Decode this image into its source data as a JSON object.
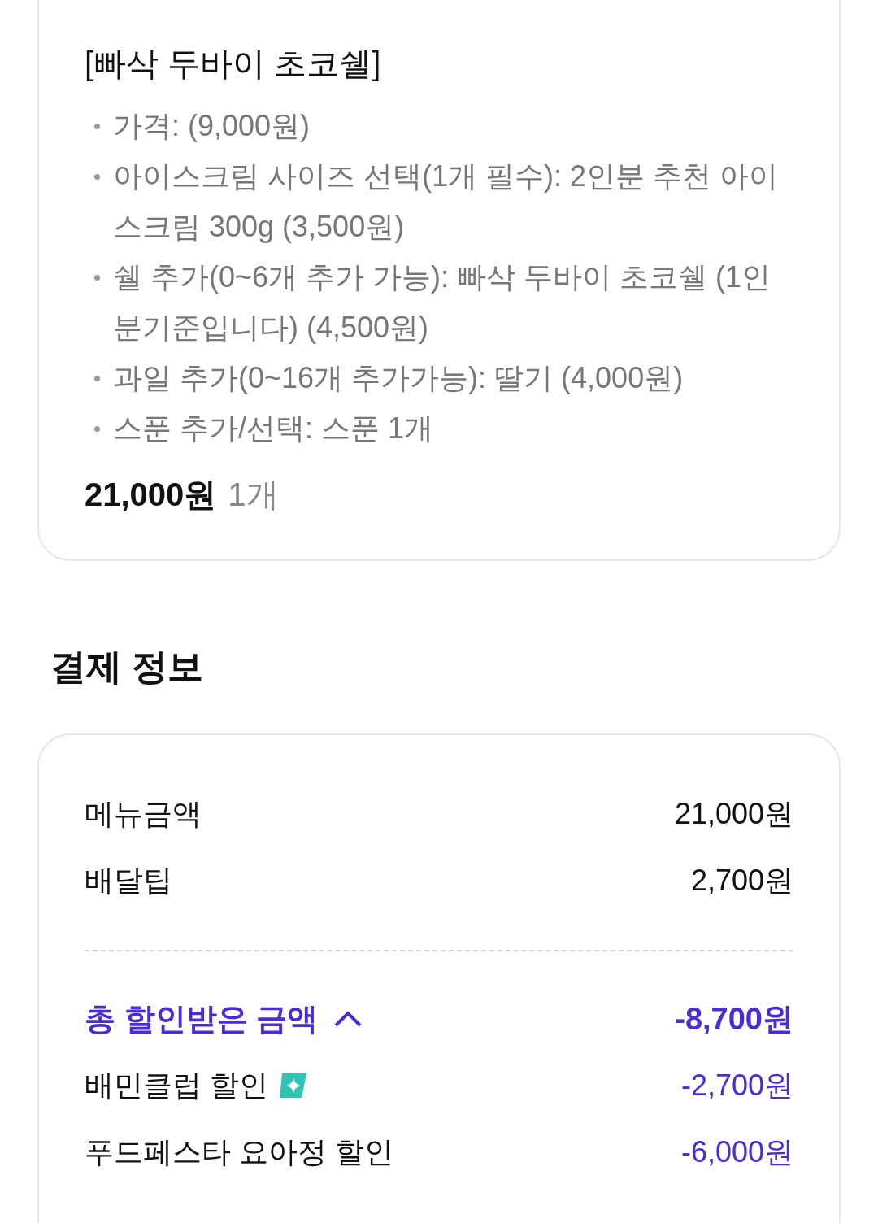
{
  "order_item": {
    "name": "[빠삭 두바이 초코쉘]",
    "options": [
      "가격: (9,000원)",
      "아이스크림 사이즈 선택(1개 필수): 2인분 추천 아이스크림 300g (3,500원)",
      "쉘 추가(0~6개 추가 가능): 빠삭 두바이 초코쉘 (1인분기준입니다) (4,500원)",
      "과일 추가(0~16개 추가가능): 딸기 (4,000원)",
      "스푼 추가/선택: 스푼 1개"
    ],
    "price": "21,000원",
    "quantity": "1개"
  },
  "payment": {
    "title": "결제 정보",
    "rows": [
      {
        "label": "메뉴금액",
        "amount": "21,000원"
      },
      {
        "label": "배달팁",
        "amount": "2,700원"
      }
    ],
    "discount": {
      "label": "총 할인받은 금액",
      "amount": "-8,700원",
      "expanded": true,
      "items": [
        {
          "label": "배민클럽 할인",
          "amount": "-2,700원",
          "badge": true
        },
        {
          "label": "푸드페스타 요아정 할인",
          "amount": "-6,000원",
          "badge": false
        }
      ]
    }
  }
}
